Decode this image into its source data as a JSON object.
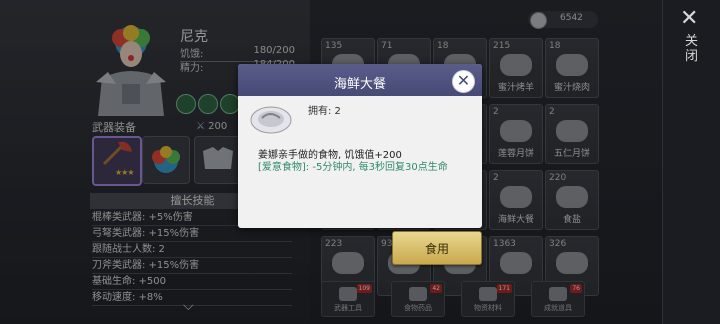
{
  "hero": {
    "name": "尼克",
    "hunger_label": "饥饿:",
    "hunger_value": "180/200",
    "energy_label": "精力:",
    "energy_value": "184/200",
    "weapon_section": "武器装备",
    "attack_value": "200",
    "skills_title": "擅长技能",
    "skills": [
      "棍棒类武器: +5%伤害",
      "弓弩类武器: +15%伤害",
      "跟随战士人数: 2",
      "刀斧类武器: +15%伤害",
      "基础生命: +500",
      "移动速度: +8%"
    ]
  },
  "currency": {
    "amount": "6542",
    "icon": "silver-coin-icon"
  },
  "inventory": {
    "items": [
      {
        "count": "135",
        "name": ""
      },
      {
        "count": "71",
        "name": ""
      },
      {
        "count": "18",
        "name": ""
      },
      {
        "count": "215",
        "name": "蜜汁烤羊"
      },
      {
        "count": "18",
        "name": "蜜汁烧肉"
      },
      {
        "count": "",
        "name": ""
      },
      {
        "count": "",
        "name": ""
      },
      {
        "count": "",
        "name": ""
      },
      {
        "count": "2",
        "name": "莲蓉月饼"
      },
      {
        "count": "2",
        "name": "五仁月饼"
      },
      {
        "count": "",
        "name": "草莓"
      },
      {
        "count": "",
        "name": "水果沙拉"
      },
      {
        "count": "",
        "name": ""
      },
      {
        "count": "2",
        "name": "海鲜大餐"
      },
      {
        "count": "220",
        "name": "食盐"
      },
      {
        "count": "223",
        "name": ""
      },
      {
        "count": "93",
        "name": ""
      },
      {
        "count": "",
        "name": ""
      },
      {
        "count": "1363",
        "name": ""
      },
      {
        "count": "326",
        "name": ""
      }
    ],
    "tabs": [
      {
        "label": "武器工具",
        "badge": "109"
      },
      {
        "label": "食物药品",
        "badge": "42"
      },
      {
        "label": "物资材料",
        "badge": "171"
      },
      {
        "label": "成就道具",
        "badge": "76"
      }
    ]
  },
  "side_panel": {
    "close_label": "关闭"
  },
  "dialog": {
    "title": "海鲜大餐",
    "owned_text": "拥有: 2",
    "description": "姜娜亲手做的食物, 饥饿值+200",
    "effect": "[爱意食物]: -5分钟内, 每3秒回复30点生命",
    "use_label": "食用"
  },
  "colors": {
    "dialog_header": "#4f5280",
    "effect_text": "#2f8b6a",
    "use_button": "#d8bf6a",
    "badge": "#b32c2c"
  }
}
